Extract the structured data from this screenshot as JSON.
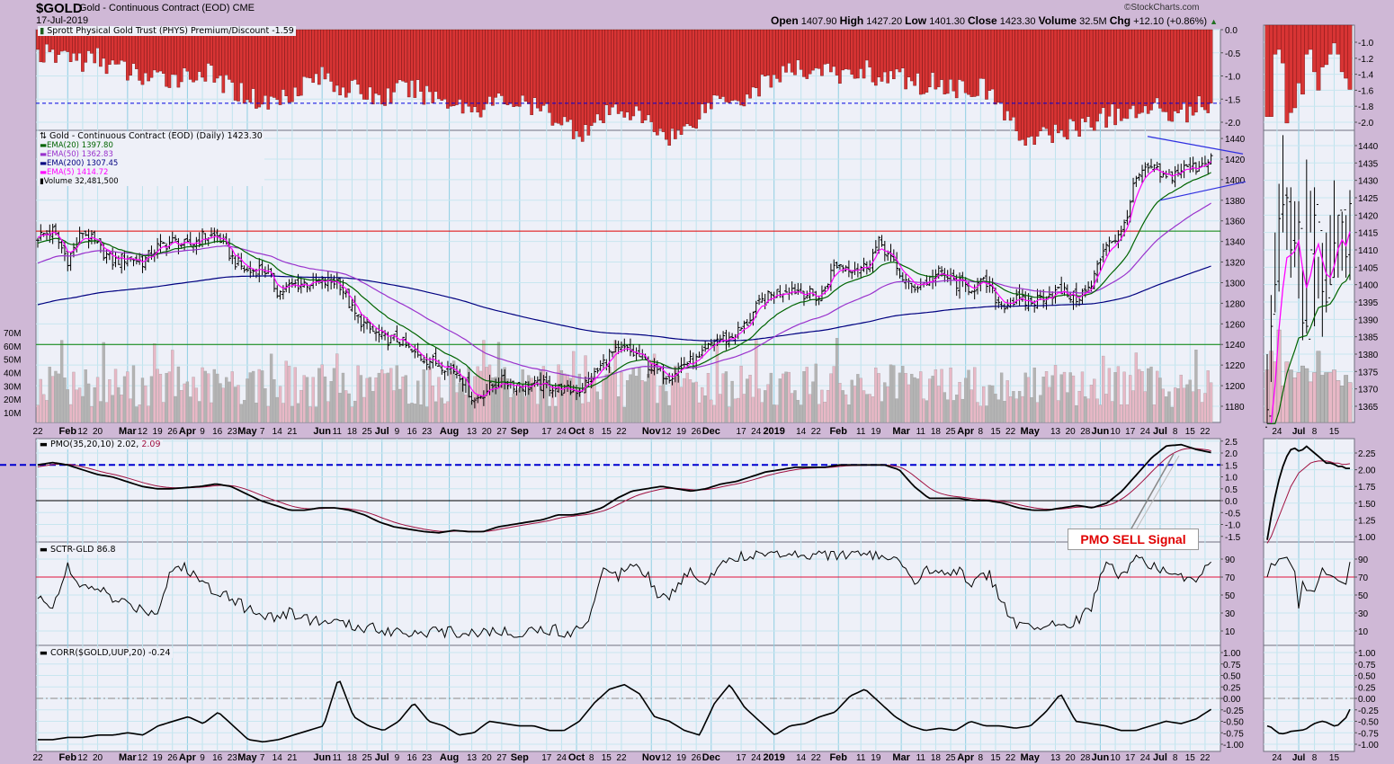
{
  "header": {
    "symbol": "$GOLD",
    "name": "Gold - Continuous Contract (EOD) CME",
    "date": "17-Jul-2019",
    "copyright": "©StockCharts.com",
    "open_label": "Open",
    "open": "1407.90",
    "high_label": "High",
    "high": "1427.20",
    "low_label": "Low",
    "low": "1401.30",
    "close_label": "Close",
    "close": "1423.30",
    "volume_label": "Volume",
    "volume": "32.5M",
    "chg_label": "Chg",
    "chg": "+12.10 (+0.86%)",
    "chg_icon": "up-triangle-icon"
  },
  "legends": {
    "phys": "Sprott Physical Gold Trust (PHYS) Premium/Discount -1.59",
    "price": "Gold - Continuous Contract (EOD) (Daily) 1423.30",
    "ema20": "EMA(20) 1397.80",
    "ema50": "EMA(50) 1362.83",
    "ema200": "EMA(200) 1307.45",
    "ema5": "EMA(5) 1414.72",
    "volume": "Volume 32,481,500",
    "pmo_main": "PMO(35,20,10) 2.02,",
    "pmo_signal": "2.09",
    "sctr": "SCTR-GLD 86.8",
    "corr": "CORR($GOLD,UUP,20) -0.24"
  },
  "annotation": {
    "text": "PMO SELL Signal"
  },
  "colors": {
    "ema20": "#006400",
    "ema50": "#9932cc",
    "ema200": "#000080",
    "ema5": "#ff00ff",
    "phys_bar": "#d83434",
    "pmo": "#000000",
    "pmo_signal": "#a01040",
    "resistance": "#e00000",
    "support": "#008000",
    "trendline": "#3030e0",
    "vol_up": "#e8b8c6",
    "vol_down": "#b4b4b4"
  },
  "chart_data": {
    "type": "ohlc",
    "title": "$GOLD Gold - Continuous Contract (EOD) CME",
    "period": "Daily, 22-Jan-2018 to 17-Jul-2019",
    "x_labels": [
      {
        "t": "22",
        "w": 0
      },
      {
        "t": "Feb",
        "w": 2,
        "b": 1
      },
      {
        "t": "12",
        "w": 3
      },
      {
        "t": "20",
        "w": 4
      },
      {
        "t": "Mar",
        "w": 6,
        "b": 1
      },
      {
        "t": "12",
        "w": 7
      },
      {
        "t": "19",
        "w": 8
      },
      {
        "t": "26",
        "w": 9
      },
      {
        "t": "Apr",
        "w": 10,
        "b": 1
      },
      {
        "t": "9",
        "w": 11
      },
      {
        "t": "16",
        "w": 12
      },
      {
        "t": "23",
        "w": 13
      },
      {
        "t": "May",
        "w": 14,
        "b": 1
      },
      {
        "t": "7",
        "w": 15
      },
      {
        "t": "14",
        "w": 16
      },
      {
        "t": "21",
        "w": 17
      },
      {
        "t": "Jun",
        "w": 19,
        "b": 1
      },
      {
        "t": "11",
        "w": 20
      },
      {
        "t": "18",
        "w": 21
      },
      {
        "t": "25",
        "w": 22
      },
      {
        "t": "Jul",
        "w": 23,
        "b": 1
      },
      {
        "t": "9",
        "w": 24
      },
      {
        "t": "16",
        "w": 25
      },
      {
        "t": "23",
        "w": 26
      },
      {
        "t": "Aug",
        "w": 27.5,
        "b": 1
      },
      {
        "t": "13",
        "w": 29
      },
      {
        "t": "20",
        "w": 30
      },
      {
        "t": "27",
        "w": 31
      },
      {
        "t": "Sep",
        "w": 32.2,
        "b": 1
      },
      {
        "t": "17",
        "w": 34
      },
      {
        "t": "24",
        "w": 35
      },
      {
        "t": "Oct",
        "w": 36,
        "b": 1
      },
      {
        "t": "8",
        "w": 37
      },
      {
        "t": "15",
        "w": 38
      },
      {
        "t": "22",
        "w": 39
      },
      {
        "t": "Nov",
        "w": 41,
        "b": 1
      },
      {
        "t": "12",
        "w": 42
      },
      {
        "t": "19",
        "w": 43
      },
      {
        "t": "26",
        "w": 44
      },
      {
        "t": "Dec",
        "w": 45,
        "b": 1
      },
      {
        "t": "17",
        "w": 47
      },
      {
        "t": "24",
        "w": 48
      },
      {
        "t": "2019",
        "w": 49.2,
        "b": 1
      },
      {
        "t": "14",
        "w": 51
      },
      {
        "t": "22",
        "w": 52
      },
      {
        "t": "Feb",
        "w": 53.5,
        "b": 1
      },
      {
        "t": "11",
        "w": 55
      },
      {
        "t": "19",
        "w": 56
      },
      {
        "t": "Mar",
        "w": 57.7,
        "b": 1
      },
      {
        "t": "11",
        "w": 59
      },
      {
        "t": "18",
        "w": 60
      },
      {
        "t": "25",
        "w": 61
      },
      {
        "t": "Apr",
        "w": 62,
        "b": 1
      },
      {
        "t": "8",
        "w": 63
      },
      {
        "t": "15",
        "w": 64
      },
      {
        "t": "22",
        "w": 65
      },
      {
        "t": "May",
        "w": 66.3,
        "b": 1
      },
      {
        "t": "13",
        "w": 68
      },
      {
        "t": "20",
        "w": 69
      },
      {
        "t": "28",
        "w": 70
      },
      {
        "t": "Jun",
        "w": 71,
        "b": 1
      },
      {
        "t": "10",
        "w": 72
      },
      {
        "t": "17",
        "w": 73
      },
      {
        "t": "24",
        "w": 74
      },
      {
        "t": "Jul",
        "w": 75,
        "b": 1
      },
      {
        "t": "8",
        "w": 76
      },
      {
        "t": "15",
        "w": 77
      },
      {
        "t": "22",
        "w": 78
      }
    ],
    "weekly_close": [
      1345,
      1350,
      1322,
      1350,
      1335,
      1320,
      1325,
      1320,
      1335,
      1340,
      1335,
      1345,
      1345,
      1322,
      1310,
      1315,
      1290,
      1298,
      1300,
      1300,
      1302,
      1270,
      1255,
      1245,
      1245,
      1230,
      1225,
      1220,
      1213,
      1185,
      1198,
      1205,
      1200,
      1200,
      1200,
      1195,
      1196,
      1210,
      1230,
      1235,
      1228,
      1215,
      1210,
      1222,
      1225,
      1245,
      1246,
      1258,
      1280,
      1290,
      1295,
      1290,
      1285,
      1318,
      1315,
      1315,
      1340,
      1315,
      1295,
      1300,
      1310,
      1300,
      1295,
      1300,
      1278,
      1283,
      1280,
      1288,
      1292,
      1285,
      1295,
      1340,
      1345,
      1400,
      1412,
      1400,
      1410,
      1412,
      1423.3
    ],
    "last_volume_m": 32.48,
    "price_axis": {
      "ticks": [
        1180,
        1200,
        1220,
        1240,
        1260,
        1280,
        1300,
        1320,
        1340,
        1360,
        1380,
        1400,
        1420,
        1440
      ]
    },
    "volume_axis": {
      "ticks": [
        "10M",
        "20M",
        "30M",
        "40M",
        "50M",
        "60M",
        "70M"
      ]
    },
    "horizontal_lines": [
      {
        "value": 1350,
        "color": "resistance+support"
      },
      {
        "value": 1240,
        "color": "support"
      }
    ],
    "trendlines": {
      "upper": [
        1442,
        1425
      ],
      "lower": [
        1380,
        1398
      ]
    },
    "phys": {
      "ticks": [
        "0.0",
        "-0.5",
        "-1.0",
        "-1.5",
        "-2.0"
      ],
      "reference": -1.59,
      "weekly": [
        -0.5,
        -0.6,
        -0.5,
        -0.7,
        -0.6,
        -0.8,
        -0.9,
        -1.0,
        -1.1,
        -1.0,
        -1.0,
        -0.9,
        -1.1,
        -1.3,
        -1.4,
        -1.6,
        -1.5,
        -1.3,
        -1.1,
        -1.0,
        -1.2,
        -1.3,
        -1.4,
        -1.5,
        -1.3,
        -1.3,
        -1.4,
        -1.5,
        -1.6,
        -1.7,
        -1.6,
        -1.5,
        -1.6,
        -1.7,
        -1.8,
        -2.0,
        -2.2,
        -2.1,
        -1.8,
        -1.7,
        -1.9,
        -2.1,
        -2.3,
        -2.2,
        -1.8,
        -1.5,
        -1.4,
        -1.5,
        -1.2,
        -1.0,
        -0.9,
        -0.9,
        -0.8,
        -1.0,
        -1.0,
        -0.8,
        -1.1,
        -1.0,
        -1.1,
        -1.2,
        -1.1,
        -1.3,
        -1.2,
        -1.3,
        -1.6,
        -2.2,
        -2.4,
        -2.3,
        -2.2,
        -2.1,
        -2.0,
        -1.9,
        -1.8,
        -1.9,
        -1.6,
        -1.7,
        -1.8,
        -1.7,
        -1.59
      ]
    },
    "pmo": {
      "ticks": [
        "2.5",
        "2.0",
        "1.5",
        "1.0",
        "0.5",
        "0.0",
        "-0.5",
        "-1.0",
        "-1.5"
      ],
      "reference": 1.5,
      "weekly": [
        1.5,
        1.6,
        1.5,
        1.3,
        1.1,
        1.0,
        0.8,
        0.6,
        0.5,
        0.5,
        0.55,
        0.6,
        0.7,
        0.6,
        0.3,
        0.0,
        -0.2,
        -0.4,
        -0.4,
        -0.3,
        -0.3,
        -0.4,
        -0.6,
        -0.9,
        -1.1,
        -1.2,
        -1.3,
        -1.35,
        -1.25,
        -1.3,
        -1.3,
        -1.1,
        -1.0,
        -0.9,
        -0.8,
        -0.6,
        -0.6,
        -0.5,
        -0.3,
        0.1,
        0.4,
        0.5,
        0.6,
        0.5,
        0.4,
        0.5,
        0.7,
        0.8,
        1.0,
        1.2,
        1.3,
        1.4,
        1.4,
        1.4,
        1.5,
        1.5,
        1.5,
        1.5,
        1.3,
        0.6,
        0.1,
        0.1,
        0.1,
        0.0,
        0.0,
        -0.1,
        -0.3,
        -0.4,
        -0.4,
        -0.3,
        -0.2,
        -0.3,
        -0.1,
        0.4,
        1.1,
        1.8,
        2.3,
        2.35,
        2.15,
        2.02
      ],
      "last_signal": 2.09
    },
    "sctr": {
      "ticks": [
        "90",
        "70",
        "50",
        "30",
        "10"
      ],
      "reference": 70,
      "weekly": [
        45,
        40,
        80,
        55,
        60,
        45,
        40,
        35,
        30,
        80,
        80,
        65,
        55,
        50,
        35,
        30,
        25,
        30,
        25,
        20,
        20,
        15,
        15,
        12,
        10,
        10,
        8,
        8,
        8,
        8,
        10,
        8,
        8,
        10,
        12,
        10,
        8,
        20,
        80,
        70,
        90,
        75,
        45,
        55,
        80,
        60,
        90,
        92,
        95,
        97,
        97,
        97,
        96,
        96,
        95,
        95,
        95,
        93,
        85,
        60,
        80,
        75,
        80,
        60,
        75,
        40,
        15,
        12,
        15,
        20,
        20,
        40,
        88,
        70,
        95,
        80,
        75,
        70,
        65,
        86.8
      ]
    },
    "corr": {
      "ticks": [
        "1.00",
        "0.75",
        "0.50",
        "0.25",
        "0.00",
        "-0.25",
        "-0.50",
        "-0.75",
        "-1.00"
      ],
      "weekly": [
        -0.9,
        -0.9,
        -0.85,
        -0.85,
        -0.8,
        -0.8,
        -0.75,
        -0.8,
        -0.6,
        -0.5,
        -0.4,
        -0.55,
        -0.3,
        -0.6,
        -0.9,
        -0.95,
        -0.9,
        -0.8,
        -0.7,
        -0.6,
        0.45,
        -0.4,
        -0.6,
        -0.7,
        -0.5,
        -0.1,
        -0.5,
        -0.6,
        -0.8,
        -0.75,
        -0.5,
        -0.55,
        -0.6,
        -0.6,
        -0.7,
        -0.7,
        -0.5,
        -0.1,
        0.2,
        0.3,
        0.1,
        -0.4,
        -0.5,
        -0.7,
        -0.8,
        -0.1,
        0.3,
        -0.2,
        -0.5,
        -0.8,
        -0.6,
        -0.55,
        -0.4,
        -0.3,
        0.05,
        0.2,
        -0.1,
        -0.4,
        -0.6,
        -0.7,
        -0.65,
        -0.7,
        -0.5,
        -0.6,
        -0.6,
        -0.65,
        -0.6,
        -0.3,
        0.1,
        -0.5,
        -0.55,
        -0.6,
        -0.7,
        -0.7,
        -0.6,
        -0.5,
        -0.55,
        -0.45,
        -0.24
      ]
    },
    "inset": {
      "x_labels": [
        {
          "t": "24",
          "d": 2.5
        },
        {
          "t": "Jul",
          "d": 8,
          "b": 1
        },
        {
          "t": "8",
          "d": 12
        },
        {
          "t": "15",
          "d": 17
        }
      ],
      "price_ticks": [
        1365,
        1370,
        1375,
        1380,
        1385,
        1390,
        1395,
        1400,
        1405,
        1410,
        1415,
        1420,
        1425,
        1430,
        1435,
        1440
      ],
      "close": [
        1364,
        1388,
        1400,
        1419,
        1423,
        1425,
        1410,
        1412,
        1418,
        1389,
        1388,
        1410,
        1420,
        1418,
        1398,
        1395,
        1400,
        1412,
        1420,
        1418,
        1408,
        1423.3
      ],
      "high": [
        1380,
        1397,
        1415,
        1429,
        1443,
        1428,
        1428,
        1424,
        1424,
        1405,
        1436,
        1427,
        1428,
        1408,
        1412,
        1415,
        1420,
        1430,
        1420,
        1421,
        1420,
        1427.2
      ],
      "low": [
        1360,
        1372,
        1392,
        1398,
        1415,
        1410,
        1402,
        1405,
        1396,
        1384,
        1386,
        1415,
        1388,
        1396,
        1385,
        1392,
        1400,
        1402,
        1402,
        1404,
        1402,
        1401.3
      ],
      "volume": [
        42,
        56,
        48,
        72,
        30,
        48,
        42,
        36,
        40,
        45,
        43,
        33,
        40,
        56,
        38,
        40,
        40,
        42,
        34,
        30,
        38,
        32.5
      ],
      "phys": [
        -1.93,
        -1.93,
        -1.15,
        -1.09,
        -1.26,
        -2.01,
        -1.88,
        -1.82,
        -1.51,
        -1.65,
        -1.15,
        -1.09,
        -1.37,
        -1.6,
        -1.31,
        -1.28,
        -1.15,
        -1.01,
        -1.15,
        -1.37,
        -1.45,
        -1.59
      ],
      "phys_ticks": [
        "-1.0",
        "-1.2",
        "-1.4",
        "-1.6",
        "-1.8",
        "-2.0"
      ],
      "pmo": [
        0.95,
        1.3,
        1.6,
        1.85,
        2.05,
        2.2,
        2.3,
        2.32,
        2.28,
        2.3,
        2.35,
        2.3,
        2.25,
        2.2,
        2.15,
        2.1,
        2.1,
        2.08,
        2.05,
        2.05,
        2.02,
        2.02
      ],
      "pmo_signal": [
        0.9,
        1.0,
        1.15,
        1.3,
        1.45,
        1.6,
        1.75,
        1.85,
        1.95,
        2.0,
        2.05,
        2.1,
        2.12,
        2.13,
        2.13,
        2.13,
        2.12,
        2.1,
        2.1,
        2.08,
        2.08,
        2.09
      ],
      "pmo_ticks": [
        "2.25",
        "2.00",
        "1.75",
        "1.50",
        "1.25",
        "1.00"
      ],
      "sctr": [
        70,
        85,
        83,
        90,
        91,
        92,
        84,
        76,
        35,
        65,
        55,
        55,
        54,
        66,
        80,
        73,
        72,
        70,
        66,
        64,
        62,
        86.8
      ],
      "corr": [
        -0.6,
        -0.63,
        -0.7,
        -0.76,
        -0.77,
        -0.75,
        -0.72,
        -0.71,
        -0.7,
        -0.69,
        -0.66,
        -0.6,
        -0.55,
        -0.52,
        -0.5,
        -0.52,
        -0.56,
        -0.6,
        -0.58,
        -0.5,
        -0.42,
        -0.24
      ]
    }
  }
}
